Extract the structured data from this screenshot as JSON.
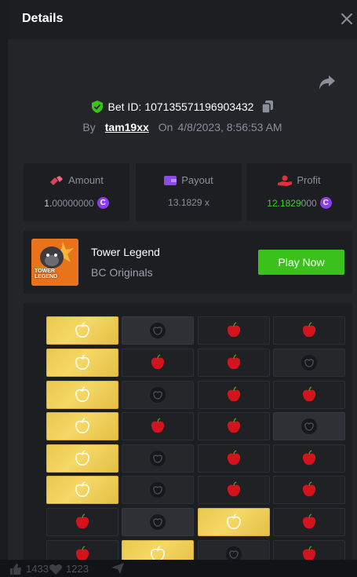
{
  "background": {
    "likes_count": "1433",
    "hearts_count": "1223"
  },
  "modal": {
    "title": "Details",
    "bet": {
      "label": "Bet ID:",
      "id": "107135571196903432",
      "by_label": "By",
      "user": "tam19xx",
      "on_label": "On",
      "datetime": "4/8/2023, 8:56:53 AM"
    },
    "stats": {
      "amount": {
        "label": "Amount",
        "value_main": "1.",
        "value_dim": "00000000"
      },
      "payout": {
        "label": "Payout",
        "value": "13.1829 x"
      },
      "profit": {
        "label": "Profit",
        "value_main": "12.1829",
        "value_dim": "000"
      }
    },
    "game": {
      "name": "Tower Legend",
      "provider": "BC Originals",
      "thumb_text": "TOWER LEGEND",
      "play_label": "Play Now"
    },
    "board": {
      "rows": [
        [
          "gold",
          "dark",
          "apple",
          "apple"
        ],
        [
          "gold",
          "apple",
          "apple",
          "dim"
        ],
        [
          "gold",
          "dim",
          "apple",
          "apple"
        ],
        [
          "gold",
          "apple",
          "apple",
          "dark"
        ],
        [
          "gold",
          "dim",
          "apple",
          "apple"
        ],
        [
          "gold",
          "dim",
          "apple",
          "apple"
        ],
        [
          "apple",
          "dark",
          "gold",
          "apple"
        ],
        [
          "apple",
          "gold",
          "dim",
          "apple"
        ]
      ]
    },
    "colors": {
      "accent_green": "#3bc11c",
      "profit_green": "#3fcf2a",
      "coin_purple": "#8c3cf2",
      "gold_tile": "#f0d05a",
      "apple_red": "#d4141c"
    }
  }
}
